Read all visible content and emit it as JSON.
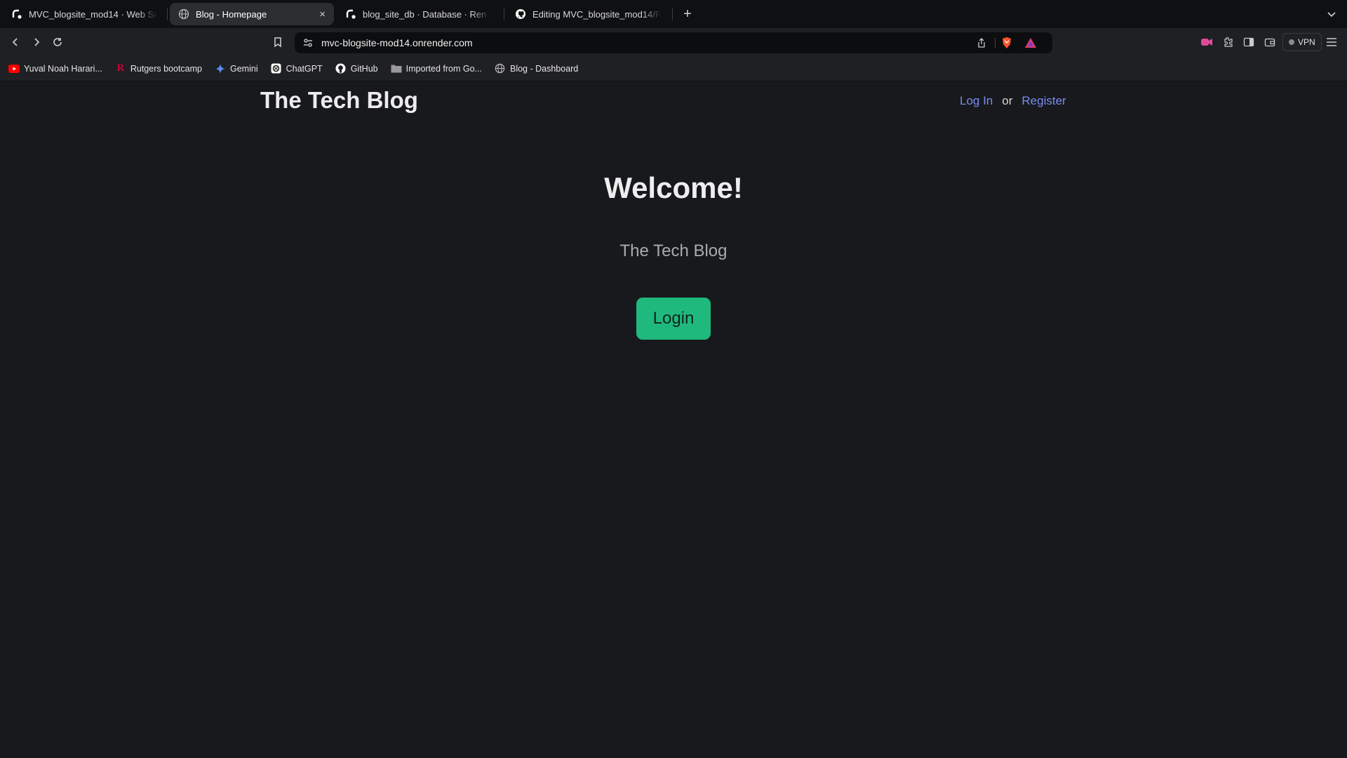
{
  "browser": {
    "tabs": [
      {
        "title": "MVC_blogsite_mod14 · Web Se",
        "active": false
      },
      {
        "title": "Blog - Homepage",
        "active": true
      },
      {
        "title": "blog_site_db · Database · Ren",
        "active": false
      },
      {
        "title": "Editing MVC_blogsite_mod14/RE",
        "active": false
      }
    ],
    "new_tab_label": "+",
    "close_label": "×",
    "url": "mvc-blogsite-mod14.onrender.com",
    "vpn_label": "VPN",
    "bookmarks": [
      {
        "label": "Yuval Noah Harari...",
        "icon": "youtube-icon"
      },
      {
        "label": "Rutgers bootcamp",
        "icon": "rutgers-icon"
      },
      {
        "label": "Gemini",
        "icon": "gemini-icon"
      },
      {
        "label": "ChatGPT",
        "icon": "chatgpt-icon"
      },
      {
        "label": "GitHub",
        "icon": "github-icon"
      },
      {
        "label": "Imported from Go...",
        "icon": "folder-icon"
      },
      {
        "label": "Blog - Dashboard",
        "icon": "globe-icon"
      }
    ]
  },
  "header": {
    "site_title": "The Tech Blog",
    "login_link": "Log In",
    "or_text": "or",
    "register_link": "Register"
  },
  "main": {
    "heading": "Welcome!",
    "subtitle": "The Tech Blog",
    "login_button": "Login"
  },
  "colors": {
    "page_background": "#17191c",
    "link": "#7b8cf0",
    "button": "#1fb97e"
  }
}
